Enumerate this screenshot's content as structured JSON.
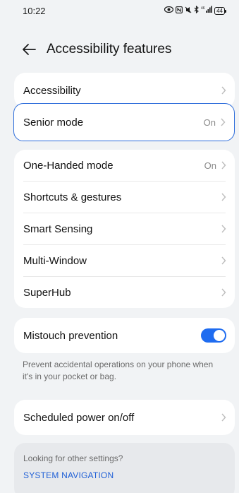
{
  "status_bar": {
    "time": "10:22",
    "battery": "44",
    "signal_label": "46"
  },
  "header": {
    "title": "Accessibility features"
  },
  "section1": {
    "items": [
      {
        "label": "Accessibility",
        "value": ""
      }
    ]
  },
  "selected_item": {
    "label": "Senior mode",
    "value": "On"
  },
  "section2": {
    "items": [
      {
        "label": "One-Handed mode",
        "value": "On"
      },
      {
        "label": "Shortcuts & gestures",
        "value": ""
      },
      {
        "label": "Smart Sensing",
        "value": ""
      },
      {
        "label": "Multi-Window",
        "value": ""
      },
      {
        "label": "SuperHub",
        "value": ""
      }
    ]
  },
  "mistouch": {
    "label": "Mistouch prevention",
    "enabled": true,
    "description": "Prevent accidental operations on your phone when it's in your pocket or bag."
  },
  "scheduled": {
    "label": "Scheduled power on/off"
  },
  "footer": {
    "prompt": "Looking for other settings?",
    "link": "SYSTEM NAVIGATION"
  },
  "colors": {
    "accent": "#1f6cf0",
    "background": "#f1f3f5",
    "card": "#ffffff",
    "selection_border": "#2d6ddb"
  }
}
